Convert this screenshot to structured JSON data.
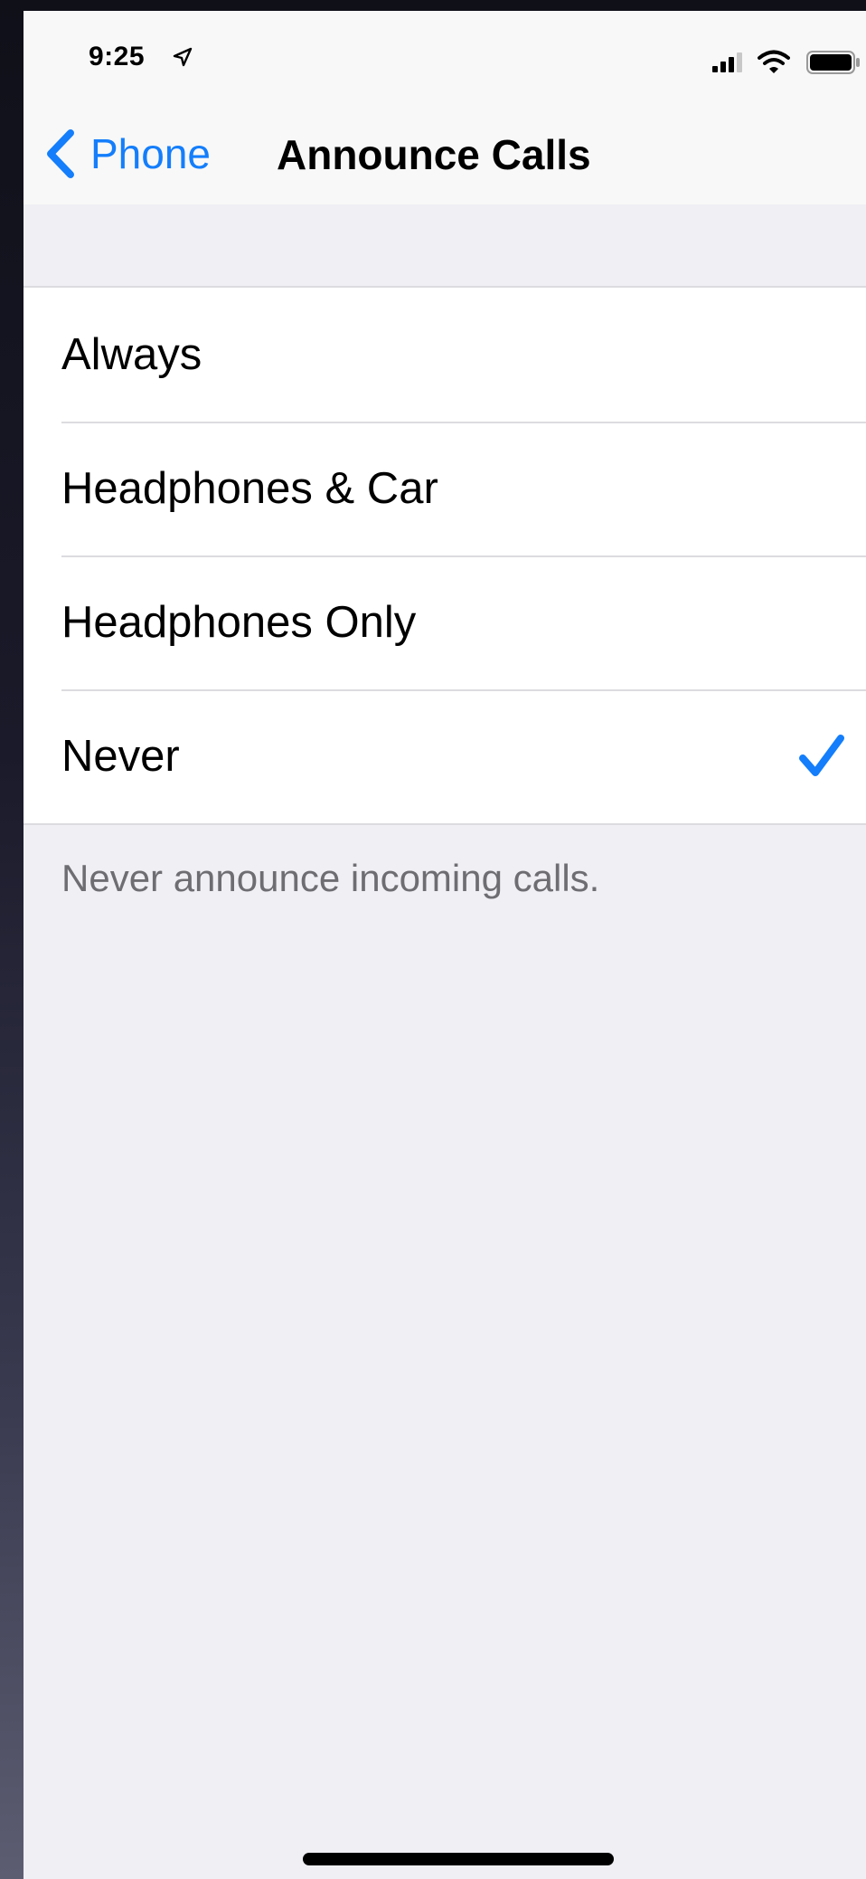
{
  "status_bar": {
    "time": "9:25",
    "location_icon": "location-arrow-icon",
    "signal_icon": "cellular-signal-icon",
    "wifi_icon": "wifi-icon",
    "battery_icon": "battery-icon"
  },
  "nav": {
    "back_label": "Phone",
    "back_icon": "chevron-left-icon",
    "title": "Announce Calls"
  },
  "options": [
    {
      "label": "Always",
      "selected": false
    },
    {
      "label": "Headphones & Car",
      "selected": false
    },
    {
      "label": "Headphones Only",
      "selected": false
    },
    {
      "label": "Never",
      "selected": true
    }
  ],
  "footer_note": "Never announce incoming calls.",
  "colors": {
    "accent": "#147efb",
    "background": "#efeff4",
    "cell": "#ffffff",
    "secondary_text": "#6d6d72"
  }
}
